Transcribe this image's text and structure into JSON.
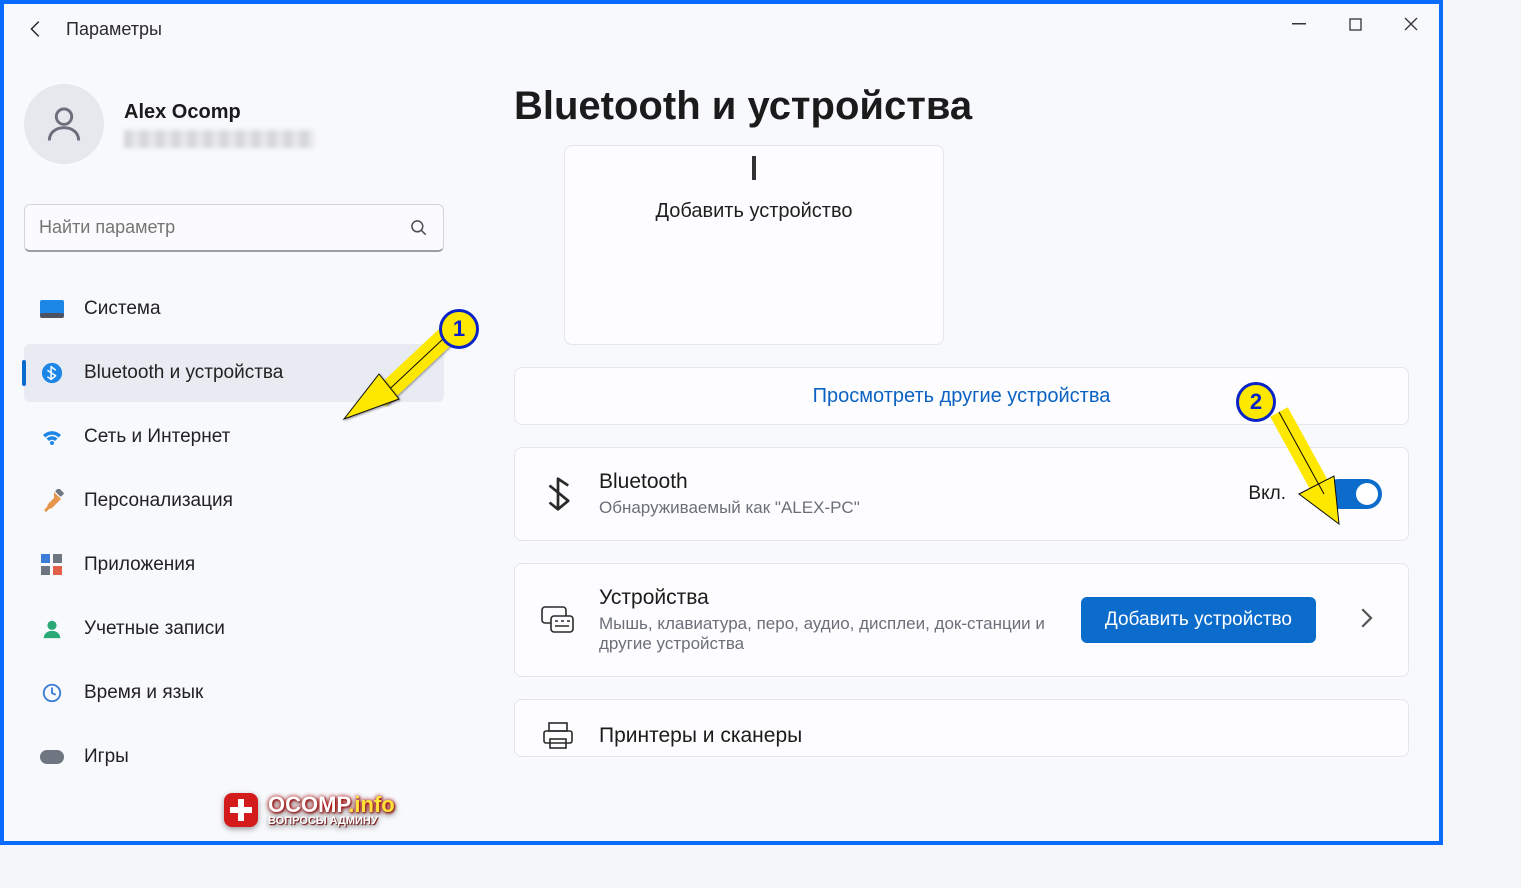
{
  "window": {
    "app_title": "Параметры"
  },
  "profile": {
    "name": "Alex Ocomp"
  },
  "search": {
    "placeholder": "Найти параметр"
  },
  "sidebar": {
    "items": [
      {
        "label": "Система"
      },
      {
        "label": "Bluetooth и устройства"
      },
      {
        "label": "Сеть и Интернет"
      },
      {
        "label": "Персонализация"
      },
      {
        "label": "Приложения"
      },
      {
        "label": "Учетные записи"
      },
      {
        "label": "Время и язык"
      },
      {
        "label": "Игры"
      }
    ]
  },
  "page": {
    "title": "Bluetooth и устройства",
    "add_device_card": "Добавить устройство",
    "view_more": "Просмотреть другие устройства",
    "bluetooth": {
      "title": "Bluetooth",
      "subtitle": "Обнаруживаемый как \"ALEX-PC\"",
      "state_label": "Вкл."
    },
    "devices": {
      "title": "Устройства",
      "subtitle": "Мышь, клавиатура, перо, аудио, дисплеи, док-станции и другие устройства",
      "button": "Добавить устройство"
    },
    "printers": {
      "title": "Принтеры и сканеры"
    }
  },
  "annotations": {
    "badge1": "1",
    "badge2": "2"
  },
  "watermark": {
    "line1a": "OCOMP",
    "line1b": ".info",
    "line2": "ВОПРОСЫ АДМИНУ"
  }
}
